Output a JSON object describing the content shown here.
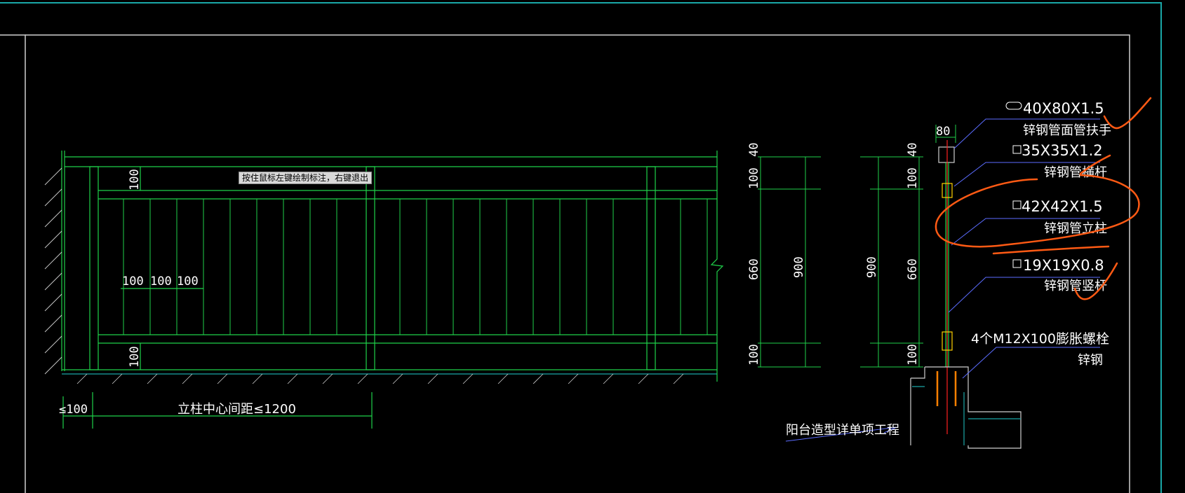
{
  "tooltip": "按住鼠标左键绘制标注，右键退出",
  "elevation": {
    "dims_top": "100",
    "dims_bottom": "100",
    "bar_spacing": [
      "100",
      "100",
      "100"
    ],
    "end_offset": "≤100",
    "post_spacing": "立柱中心间距≤1200"
  },
  "section": {
    "dims_left": [
      "40",
      "100",
      "660",
      "100"
    ],
    "total_left": "900",
    "total_right": "900",
    "dims_right": [
      "40",
      "100",
      "660",
      "100"
    ],
    "width_80": "80",
    "labels": [
      {
        "size": "40X80X1.5",
        "name": "锌钢管面管扶手"
      },
      {
        "size": "35X35X1.2",
        "name": "锌钢管横杆"
      },
      {
        "size": "42X42X1.5",
        "name": "锌钢管立柱"
      },
      {
        "size": "19X19X0.8",
        "name": "锌钢管竖杆"
      },
      {
        "size": "4个M12X100膨胀螺栓",
        "name": "锌钢"
      }
    ],
    "project_note": "阳台造型详单项工程"
  },
  "colors": {
    "line_green": "#1fd14a",
    "frame": "#cfcfcf",
    "border_teal": "#1aa7a7",
    "leader_blue": "#5b6cff",
    "markup_orange": "#ff5a14",
    "rebar_red": "#ff2020",
    "anchor_yellow": "#ffd000"
  }
}
